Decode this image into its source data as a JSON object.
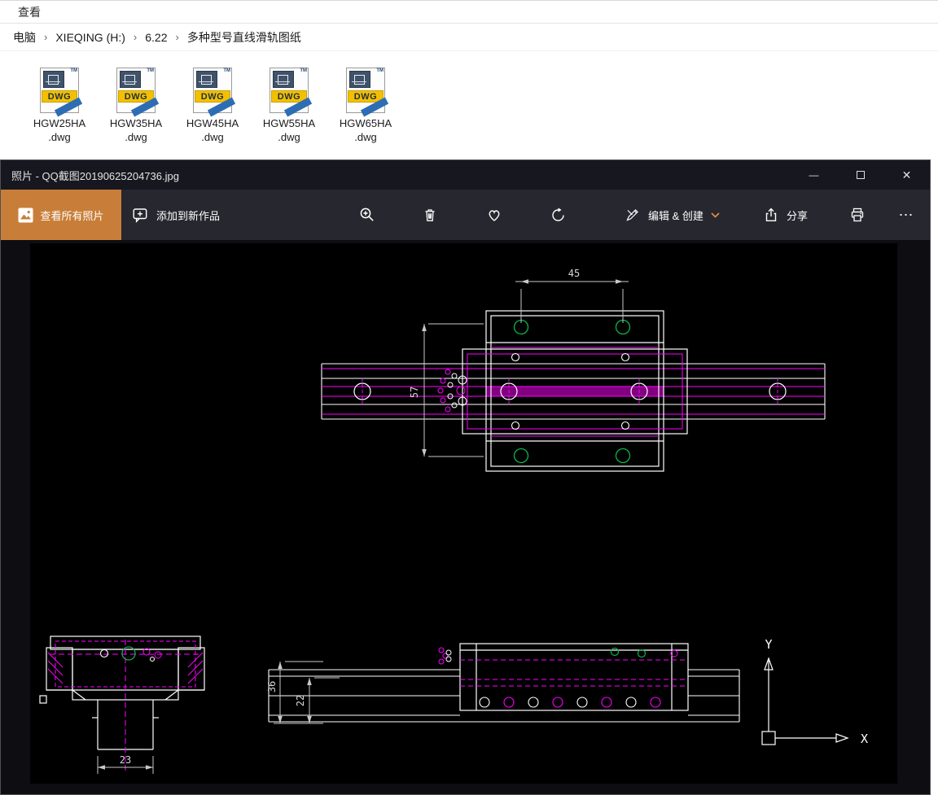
{
  "explorer": {
    "menu": {
      "view": "查看"
    },
    "breadcrumb": {
      "separator": "›",
      "items": [
        "电脑",
        "XIEQING (H:)",
        "6.22",
        "多种型号直线滑轨图纸"
      ]
    },
    "dwg_icon": {
      "label": "DWG",
      "tm": "TM"
    },
    "files": [
      {
        "name": "HGW25HA",
        "ext": ".dwg"
      },
      {
        "name": "HGW35HA",
        "ext": ".dwg"
      },
      {
        "name": "HGW45HA",
        "ext": ".dwg"
      },
      {
        "name": "HGW55HA",
        "ext": ".dwg"
      },
      {
        "name": "HGW65HA",
        "ext": ".dwg"
      }
    ]
  },
  "photos": {
    "title": "照片 - QQ截图20190625204736.jpg",
    "controls": {
      "minimize": "—",
      "close": "✕"
    },
    "toolbar": {
      "see_all": "查看所有照片",
      "add_to": "添加到新作品",
      "edit_create": "编辑 & 创建",
      "share": "分享",
      "more": "⋯"
    }
  },
  "drawing": {
    "dims": {
      "top_width": "45",
      "height": "57",
      "bottom_width": "23",
      "side_total": "36",
      "side_inner": "22"
    },
    "axes": {
      "x": "X",
      "y": "Y"
    }
  },
  "colors": {
    "accent_orange": "#c87e38",
    "cad_white": "#ffffff",
    "cad_magenta": "#ff00ff",
    "cad_green": "#0db14b"
  }
}
